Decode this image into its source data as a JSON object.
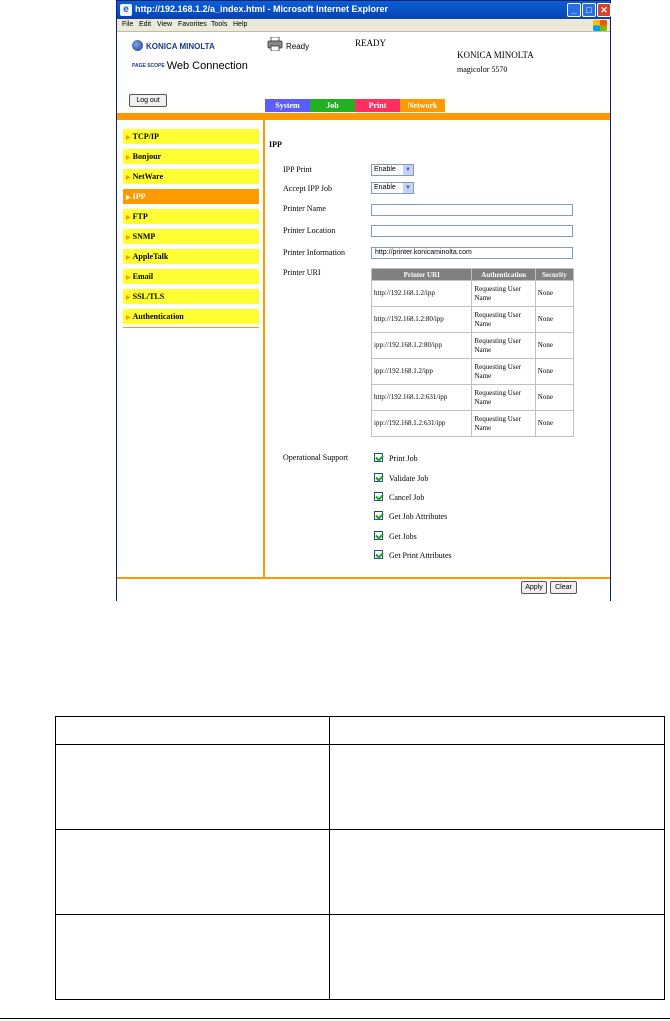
{
  "window": {
    "title": "http://192.168.1.2/a_index.html - Microsoft Internet Explorer",
    "menu": [
      "File",
      "Edit",
      "View",
      "Favorites",
      "Tools",
      "Help"
    ]
  },
  "header": {
    "brand_logo": "KONICA MINOLTA",
    "product_logo_badge": "PAGE SCOPE",
    "product_logo": "Web Connection",
    "status_text": "Ready",
    "status_big": "READY",
    "model_brand": "KONICA MINOLTA",
    "model_name": "magicolor 5570",
    "logout_label": "Log out"
  },
  "tabs": [
    {
      "label": "System",
      "color": "#5c5cff"
    },
    {
      "label": "Job",
      "color": "#22b022"
    },
    {
      "label": "Print",
      "color": "#ff3060"
    },
    {
      "label": "Network",
      "color": "#ff9900",
      "active": true
    }
  ],
  "sidebar": {
    "items": [
      {
        "label": "TCP/IP"
      },
      {
        "label": "Bonjour"
      },
      {
        "label": "NetWare"
      },
      {
        "label": "IPP",
        "active": true
      },
      {
        "label": "FTP"
      },
      {
        "label": "SNMP"
      },
      {
        "label": "AppleTalk"
      },
      {
        "label": "Email"
      },
      {
        "label": "SSL/TLS"
      },
      {
        "label": "Authentication"
      }
    ]
  },
  "main": {
    "section_title": "IPP",
    "ipp_print": {
      "label": "IPP Print",
      "value": "Enable"
    },
    "accept_ipp_job": {
      "label": "Accept IPP Job",
      "value": "Enable"
    },
    "printer_name": {
      "label": "Printer Name",
      "value": ""
    },
    "printer_location": {
      "label": "Printer Location",
      "value": ""
    },
    "printer_information": {
      "label": "Printer Information",
      "value": "http://printer.konicaminolta.com"
    },
    "printer_uri_label": "Printer URI",
    "uri_table": {
      "headers": [
        "Printer URI",
        "Authentication",
        "Security"
      ],
      "rows": [
        [
          "http://192.168.1.2/ipp",
          "Requesting User Name",
          "None"
        ],
        [
          "http://192.168.1.2:80/ipp",
          "Requesting User Name",
          "None"
        ],
        [
          "ipp://192.168.1.2:80/ipp",
          "Requesting User Name",
          "None"
        ],
        [
          "ipp://192.168.1.2/ipp",
          "Requesting User Name",
          "None"
        ],
        [
          "http://192.168.1.2:631/ipp",
          "Requesting User Name",
          "None"
        ],
        [
          "ipp://192.168.1.2:631/ipp",
          "Requesting User Name",
          "None"
        ]
      ]
    },
    "operational_support_label": "Operational Support",
    "operations": [
      {
        "label": "Print Job",
        "checked": true
      },
      {
        "label": "Validate Job",
        "checked": true
      },
      {
        "label": "Cancel Job",
        "checked": true
      },
      {
        "label": "Get Job Attributes",
        "checked": true
      },
      {
        "label": "Get Jobs",
        "checked": true
      },
      {
        "label": "Get Print Attributes",
        "checked": true
      }
    ],
    "apply_label": "Apply",
    "clear_label": "Clear"
  },
  "colors": {
    "accent_orange": "#ff9900",
    "sidebar_yellow": "#ffff33",
    "titlebar_blue": "#0a5fd8"
  }
}
